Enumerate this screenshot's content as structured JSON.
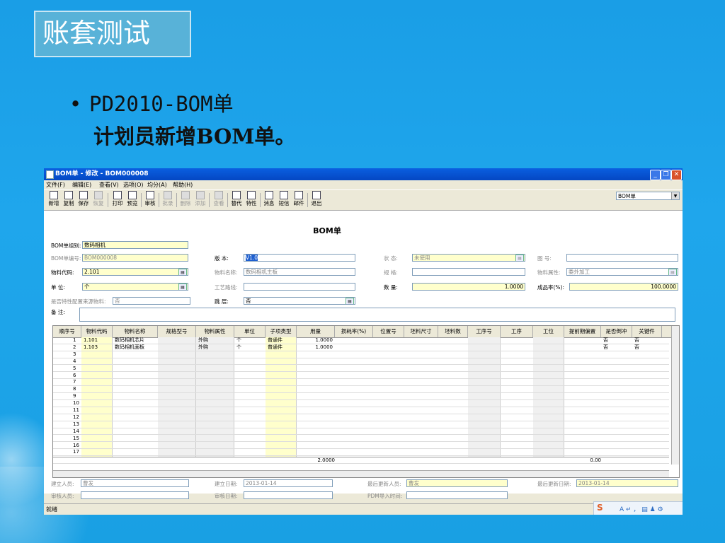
{
  "slide": {
    "title": "账套测试",
    "bullet_dot": "•",
    "bullet_line1": "PD2010-BOM单",
    "bullet_line2": "计划员新增BOM单。"
  },
  "window": {
    "title": "BOM单 - 修改 - BOM000008",
    "buttons": {
      "minimize": "_",
      "restore": "❐",
      "close": "✕"
    },
    "menu": [
      "文件(F)",
      "编辑(E)",
      "查看(V)",
      "选项(O)",
      "均分(A)",
      "帮助(H)"
    ],
    "toolbar": [
      {
        "label": "新增",
        "icon": "new-doc-icon",
        "enabled": true
      },
      {
        "label": "复制",
        "icon": "copy-icon",
        "enabled": true
      },
      {
        "label": "保存",
        "icon": "save-icon",
        "enabled": true
      },
      {
        "label": "恢复",
        "icon": "undo-icon",
        "enabled": false
      },
      {
        "label": "打印",
        "icon": "print-icon",
        "enabled": true
      },
      {
        "label": "预览",
        "icon": "preview-icon",
        "enabled": true
      },
      {
        "label": "审核",
        "icon": "approve-icon",
        "enabled": true
      },
      {
        "label": "批录",
        "icon": "batch-icon",
        "enabled": false
      },
      {
        "label": "删除",
        "icon": "delete-icon",
        "enabled": false
      },
      {
        "label": "添加",
        "icon": "add-icon",
        "enabled": false
      },
      {
        "label": "查看",
        "icon": "view-icon",
        "enabled": false
      },
      {
        "label": "替代",
        "icon": "replace-icon",
        "enabled": true
      },
      {
        "label": "特性",
        "icon": "feature-icon",
        "enabled": true
      },
      {
        "label": "消息",
        "icon": "message-icon",
        "enabled": true
      },
      {
        "label": "短信",
        "icon": "sms-icon",
        "enabled": true
      },
      {
        "label": "邮件",
        "icon": "mail-icon",
        "enabled": true
      },
      {
        "label": "退出",
        "icon": "exit-icon",
        "enabled": true
      }
    ],
    "type_select": "BOM单",
    "status": "就绪"
  },
  "form": {
    "heading": "BOM单",
    "bom_group_label": "BOM单组别:",
    "bom_group": "数码相机",
    "bom_no_label": "BOM单编号:",
    "bom_no": "BOM000008",
    "item_code_label": "物料代码:",
    "item_code": "2.101",
    "unit_label": "单    位:",
    "unit": "个",
    "feature_src_label": "是否特性配置来源物料:",
    "feature_src": "否",
    "remark_label": "备    注:",
    "version_label": "版    本:",
    "version": "V1.0",
    "item_name_label": "物料名称:",
    "item_name": "数码相机主板",
    "route_label": "工艺路线:",
    "route": "",
    "level_label": "跳    层:",
    "level": "否",
    "state_label": "状    态:",
    "state": "未使用",
    "spec_label": "规    格:",
    "spec": "",
    "qty_label": "数    量:",
    "qty": "1.0000",
    "drawing_label": "图    号:",
    "drawing": "",
    "item_attr_label": "物料属性:",
    "item_attr": "委外加工",
    "yield_label": "成品率(%):",
    "yield": "100.0000"
  },
  "grid": {
    "headers": [
      "顺序号",
      "物料代码",
      "物料名称",
      "规格型号",
      "物料属性",
      "单位",
      "子项类型",
      "用量",
      "损耗率(%)",
      "位置号",
      "坯料尺寸",
      "坯料数",
      "工序号",
      "工序",
      "工位",
      "提前期偏置",
      "是否倒冲",
      "关键件"
    ],
    "rows": [
      [
        "1",
        "1.101",
        "数码相机芯片",
        "",
        "外购",
        "个",
        "普通件",
        "1.0000",
        "",
        "",
        "",
        "",
        "",
        "",
        "",
        "",
        "否",
        "否"
      ],
      [
        "2",
        "1.103",
        "数码相机面板",
        "",
        "外购",
        "个",
        "普通件",
        "1.0000",
        "",
        "",
        "",
        "",
        "",
        "",
        "",
        "",
        "否",
        "否"
      ],
      [
        "3"
      ],
      [
        "4"
      ],
      [
        "5"
      ],
      [
        "6"
      ],
      [
        "7"
      ],
      [
        "8"
      ],
      [
        "9"
      ],
      [
        "10"
      ],
      [
        "11"
      ],
      [
        "12"
      ],
      [
        "13"
      ],
      [
        "14"
      ],
      [
        "15"
      ],
      [
        "16"
      ],
      [
        "17"
      ]
    ],
    "total_qty": "2.0000",
    "total_lead": "0.00"
  },
  "footer": {
    "creator_label": "建立人员:",
    "creator": "曹发",
    "create_date_label": "建立日期:",
    "create_date": "2013-01-14",
    "updater_label": "最后更新人员:",
    "updater": "曹发",
    "update_date_label": "最后更新日期:",
    "update_date": "2013-01-14",
    "auditor_label": "审核人员:",
    "auditor": "",
    "audit_date_label": "审核日期:",
    "audit_date": "",
    "pdm_label": "PDM导入时间:",
    "pdm": ""
  },
  "ime": {
    "logo": "S",
    "text": "A ↵ ， ▤ ♟ ⚙"
  },
  "colors": {
    "slide_bg": "#1fa6ec",
    "title_box": "#58b2d8",
    "title_bar": "#0a5fe0",
    "field_yellow": "#ffffcc"
  }
}
